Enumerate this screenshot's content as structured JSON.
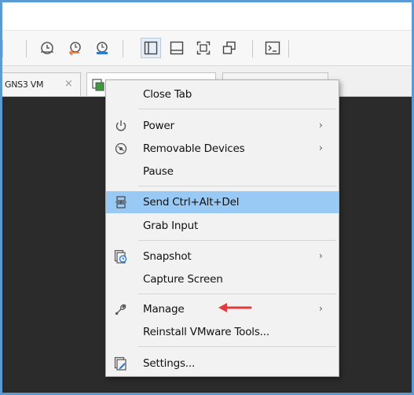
{
  "tabs": [
    {
      "label": "GNS3 VM",
      "close": "×"
    }
  ],
  "menu": {
    "items": [
      {
        "label": "Close Tab",
        "submenu": false
      },
      {
        "label": "Power",
        "submenu": true,
        "icon": "power-icon"
      },
      {
        "label": "Removable Devices",
        "submenu": true,
        "icon": "removable-devices-icon"
      },
      {
        "label": "Pause",
        "submenu": false
      },
      {
        "label": "Send Ctrl+Alt+Del",
        "submenu": false,
        "icon": "send-keys-icon",
        "highlighted": true
      },
      {
        "label": "Grab Input",
        "submenu": false
      },
      {
        "label": "Snapshot",
        "submenu": true,
        "icon": "snapshot-icon"
      },
      {
        "label": "Capture Screen",
        "submenu": false
      },
      {
        "label": "Manage",
        "submenu": true,
        "icon": "wrench-icon"
      },
      {
        "label": "Reinstall VMware Tools...",
        "submenu": false
      },
      {
        "label": "Settings...",
        "submenu": false,
        "icon": "settings-icon"
      }
    ],
    "arrow": "›"
  },
  "colors": {
    "frame_border": "#5b9bd5",
    "highlight": "#99c9f5",
    "annotation_arrow": "#e03c3c",
    "vm_background": "#2b2b2b"
  }
}
